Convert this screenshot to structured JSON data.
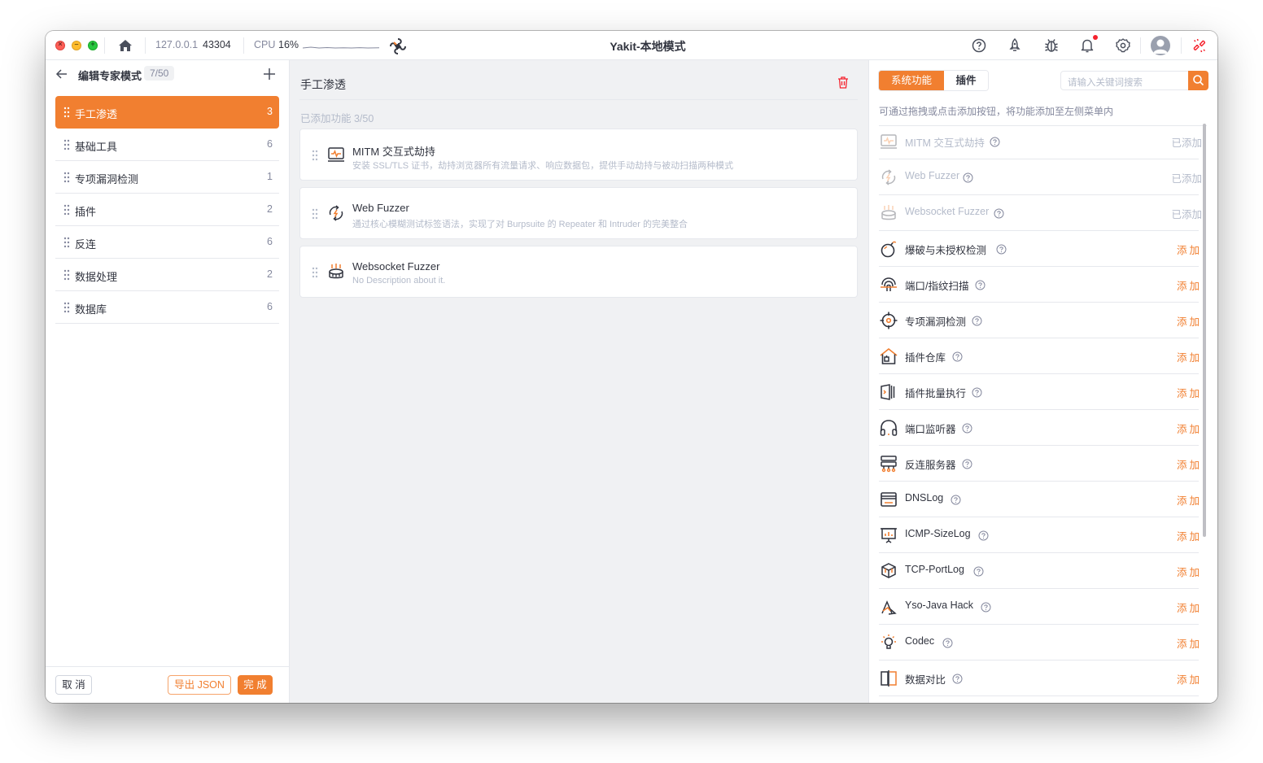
{
  "app": {
    "title": "Yakit-本地模式",
    "host": "127.0.0.1",
    "port": "43304",
    "cpu_label": "CPU",
    "cpu_value": "16%"
  },
  "left": {
    "title": "编辑专家模式",
    "count": "7/50",
    "items": [
      {
        "label": "手工渗透",
        "count": "3"
      },
      {
        "label": "基础工具",
        "count": "6"
      },
      {
        "label": "专项漏洞检测",
        "count": "1"
      },
      {
        "label": "插件",
        "count": "2"
      },
      {
        "label": "反连",
        "count": "6"
      },
      {
        "label": "数据处理",
        "count": "2"
      },
      {
        "label": "数据库",
        "count": "6"
      }
    ],
    "cancel_label": "取 消",
    "export_label": "导出 JSON",
    "done_label": "完 成"
  },
  "middle": {
    "title": "手工渗透",
    "added_label": "已添加功能 3/50",
    "cards": [
      {
        "name": "MITM 交互式劫持",
        "desc": "安装 SSL/TLS 证书，劫持浏览器所有流量请求、响应数据包，提供手动劫持与被动扫描两种模式",
        "icon": "mitm-icon"
      },
      {
        "name": "Web Fuzzer",
        "desc": "通过核心模糊测试标签语法，实现了对 Burpsuite 的 Repeater 和 Intruder 的完美整合",
        "icon": "web-fuzzer-icon"
      },
      {
        "name": "Websocket Fuzzer",
        "desc": "No Description about it.",
        "icon": "websocket-fuzzer-icon"
      }
    ]
  },
  "right": {
    "tab_system": "系统功能",
    "tab_plugin": "插件",
    "search_placeholder": "请输入关键词搜索",
    "hint": "可通过拖拽或点击添加按钮，将功能添加至左侧菜单内",
    "items": [
      {
        "name": "MITM 交互式劫持",
        "action": "已添加",
        "added": true,
        "icon": "mitm-icon"
      },
      {
        "name": "Web Fuzzer",
        "action": "已添加",
        "added": true,
        "icon": "web-fuzzer-icon"
      },
      {
        "name": "Websocket Fuzzer",
        "action": "已添加",
        "added": true,
        "icon": "websocket-fuzzer-icon"
      },
      {
        "name": "爆破与未授权检测",
        "action": "添加",
        "added": false,
        "icon": "bomb-icon"
      },
      {
        "name": "端口/指纹扫描",
        "action": "添加",
        "added": false,
        "icon": "fingerprint-icon"
      },
      {
        "name": "专项漏洞检测",
        "action": "添加",
        "added": false,
        "icon": "crosshair-icon"
      },
      {
        "name": "插件仓库",
        "action": "添加",
        "added": false,
        "icon": "plugin-store-icon"
      },
      {
        "name": "插件批量执行",
        "action": "添加",
        "added": false,
        "icon": "batch-exec-icon"
      },
      {
        "name": "端口监听器",
        "action": "添加",
        "added": false,
        "icon": "headphones-icon"
      },
      {
        "name": "反连服务器",
        "action": "添加",
        "added": false,
        "icon": "server-icon"
      },
      {
        "name": "DNSLog",
        "action": "添加",
        "added": false,
        "icon": "dnslog-icon"
      },
      {
        "name": "ICMP-SizeLog",
        "action": "添加",
        "added": false,
        "icon": "icmp-icon"
      },
      {
        "name": "TCP-PortLog",
        "action": "添加",
        "added": false,
        "icon": "tcp-icon"
      },
      {
        "name": "Yso-Java Hack",
        "action": "添加",
        "added": false,
        "icon": "yso-icon"
      },
      {
        "name": "Codec",
        "action": "添加",
        "added": false,
        "icon": "codec-icon"
      },
      {
        "name": "数据对比",
        "action": "添加",
        "added": false,
        "icon": "compare-icon"
      }
    ]
  },
  "colors": {
    "accent": "#f17f30",
    "text": "#31343f",
    "muted": "#85899e",
    "disabled": "#b4bbca",
    "border": "#e6e8ed",
    "panel_bg": "#f0f1f3"
  }
}
